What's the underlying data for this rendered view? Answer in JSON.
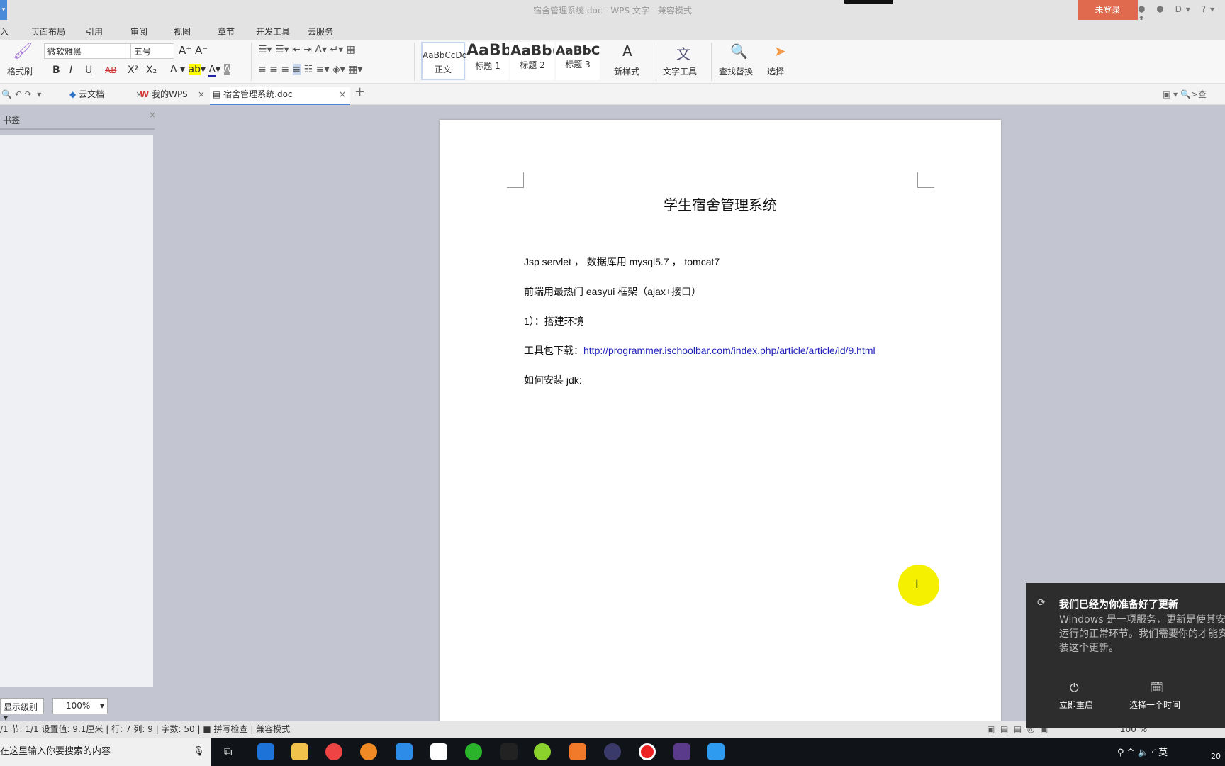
{
  "window": {
    "title": "宿舍管理系统.doc - WPS 文字 - 兼容模式",
    "login": "未登录",
    "icons": "⬢ ⬢ D▾ ?▾ ⬆"
  },
  "menu": [
    "入",
    "页面布局",
    "引用",
    "审阅",
    "视图",
    "章节",
    "开发工具",
    "云服务"
  ],
  "ribbon": {
    "format_painter": "格式刷",
    "font": "微软雅黑",
    "size": "五号",
    "bold": "B",
    "italic": "I",
    "underline": "U",
    "strike": "AB",
    "sup": "X²",
    "sub": "X₂",
    "styles": [
      {
        "preview": "AaBbCcDd",
        "label": "正文"
      },
      {
        "preview": "AaBb",
        "label": "标题 1"
      },
      {
        "preview": "AaBb(",
        "label": "标题 2"
      },
      {
        "preview": "AaBbC",
        "label": "标题 3"
      }
    ],
    "new_style": "新样式",
    "text_tools": "文字工具",
    "find_replace": "查找替换",
    "select": "选择"
  },
  "tabs": [
    {
      "label": "云文档"
    },
    {
      "label": "我的WPS"
    },
    {
      "label": "宿舍管理系统.doc"
    }
  ],
  "tabbar_right": ">查",
  "bookmarks": {
    "title": "书签",
    "level": "显示级别",
    "zoom": "100%"
  },
  "document": {
    "title": "学生宿舍管理系统",
    "lines": [
      "Jsp servlet ， 数据库用 mysql5.7 ， tomcat7",
      "前端用最热门 easyui 框架（ajax+接口）",
      "1）：搭建环境",
      "工具包下载：",
      "如何安装 jdk:"
    ],
    "link": "http://programmer.ischoolbar.com/index.php/article/article/id/9.html"
  },
  "status": {
    "text": "/1  节: 1/1  设置值: 9.1厘米 | 行: 7  列: 9 | 字数: 50 | ■ 拼写检查 | 兼容模式",
    "zoom": "100 %"
  },
  "taskbar": {
    "search": "在这里输入你要搜索的内容",
    "ime": "英",
    "clock": "20"
  },
  "notification": {
    "title": "我们已经为你准备好了更新",
    "body": "Windows 是一项服务，更新是使其安全运行的正常环节。我们需要你的才能安装这个更新。",
    "restart": "立即重启",
    "schedule": "选择一个时间"
  },
  "colors": {
    "accent": "#e06a4e",
    "link": "#2222bb"
  }
}
